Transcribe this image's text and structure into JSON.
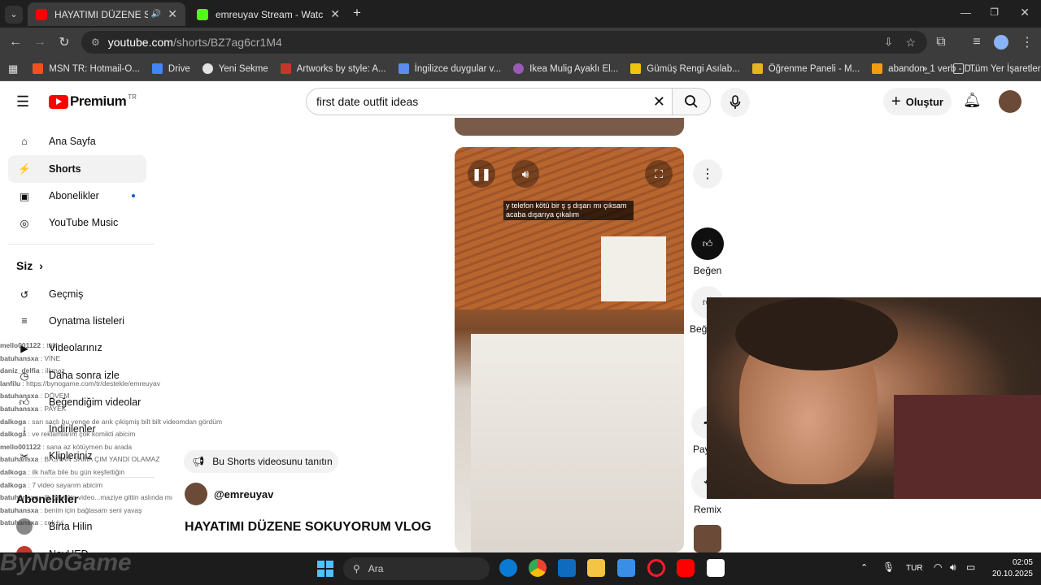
{
  "browser": {
    "tabs": [
      {
        "title": "HAYATIMI DÜZENE SOKUYORUM VLOG",
        "active": true
      },
      {
        "title": "emreuyav Stream - Watch Live on Kick",
        "active": false
      }
    ],
    "url_host": "youtube.com",
    "url_path": "/shorts/BZ7ag6cr1M4",
    "bookmarks": [
      "MSN TR: Hotmail-O...",
      "Drive",
      "Yeni Sekme",
      "Artworks by style: A...",
      "İngilizce duygular v...",
      "Ikea Mulig Ayaklı El...",
      "Gümüş Rengi Asılab...",
      "Öğrenme Paneli - M...",
      "abandon_1 verb - D..."
    ],
    "all_bookmarks": "Tüm Yer İşaretleri"
  },
  "youtube": {
    "logo": "Premium",
    "logo_region": "TR",
    "search_value": "first date outfit ideas",
    "create_label": "Oluştur",
    "sidebar": {
      "main": [
        "Ana Sayfa",
        "Shorts",
        "Abonelikler",
        "YouTube Music"
      ],
      "you_label": "Siz",
      "you_items": [
        "Geçmiş",
        "Oynatma listeleri",
        "Videolarınız",
        "Daha sonra izle",
        "Beğendiğim videolar",
        "İndirilenler",
        "Klipleriniz"
      ],
      "subs_label": "Abonelikler",
      "subs": [
        "Birta Hilin",
        "NevHED"
      ]
    },
    "short": {
      "caption": "y telefon kötü bir ş ş dışarı mı çıksam acaba dışarıya çıkalım",
      "promo": "Bu Shorts videosunu tanıtın",
      "channel": "@emreuyav",
      "title": "HAYATIMI DÜZENE SOKUYORUM VLOG",
      "like_label": "Beğen",
      "dislike_label": "Beğenme",
      "share_label": "Paylaş",
      "remix_label": "Remix"
    }
  },
  "chat": [
    {
      "user": "mello001122",
      "msg": "tülin"
    },
    {
      "user": "batuhansxa",
      "msg": "VİNE"
    },
    {
      "user": "daniz_delfia",
      "msg": "ilkmaz"
    },
    {
      "user": "lanfilu",
      "msg": "https://bynogame.com/tr/destekle/emreuyav"
    },
    {
      "user": "batuhansxa",
      "msg": "DÖVEM"
    },
    {
      "user": "batuhansxa",
      "msg": "PAYEK"
    },
    {
      "user": "dalkoga",
      "msg": "sarı saçlı bu yenge de arık çıkişmiş bilt bilt videomdan gördüm"
    },
    {
      "user": "dalkoga",
      "msg": "ve reklamlarım çok komikti abicim"
    },
    {
      "user": "mello001122",
      "msg": "sana az kötüymen bu arada"
    },
    {
      "user": "batuhansxa",
      "msg": "BASTAN SAMA ÇIM YANDI OLAMAZ"
    },
    {
      "user": "dalkoga",
      "msg": "ilk hafta bile bu gün keşfettiğin"
    },
    {
      "user": "dalkoga",
      "msg": "7 video sayarım abicim"
    },
    {
      "user": "batuhansxa",
      "msg": "ilk çektiğin video...maziye gittin aslında mı"
    },
    {
      "user": "batuhansxa",
      "msg": "benim için bağlasam seni yavaş"
    },
    {
      "user": "batuhansxa",
      "msg": "cok iyi"
    }
  ],
  "taskbar": {
    "search": "Ara",
    "lang": "TUR",
    "time": "02:05",
    "date": "20.10.2025"
  },
  "watermark": "ByNoGame"
}
